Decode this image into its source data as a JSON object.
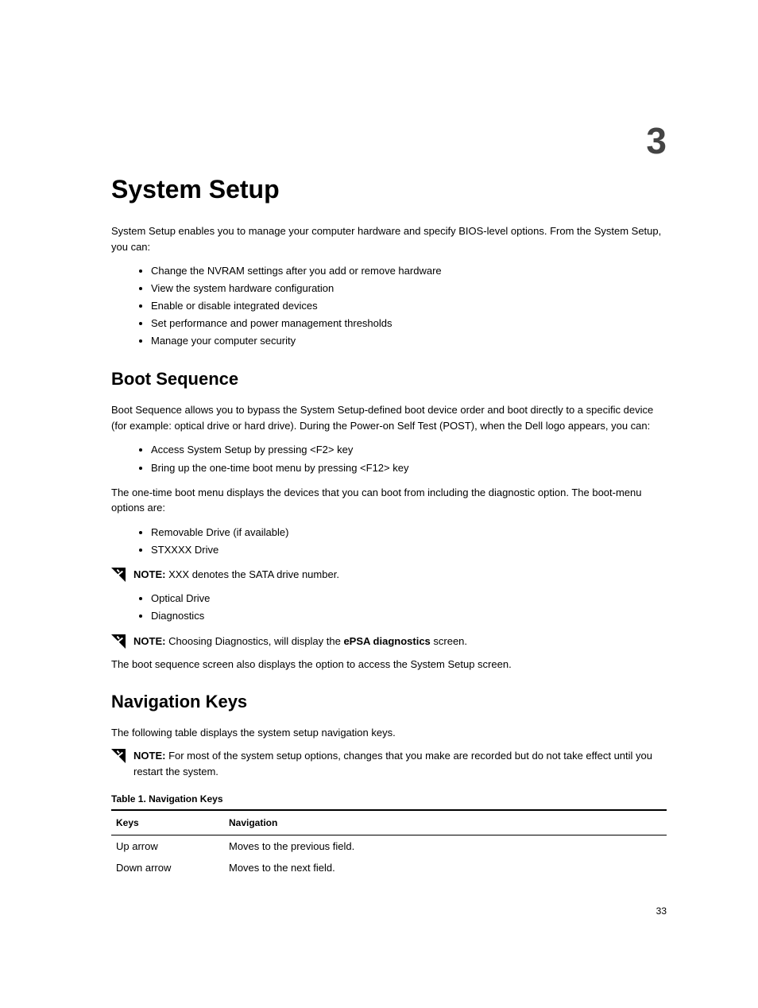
{
  "chapter": "3",
  "title": "System Setup",
  "introParagraph": "System Setup enables you to manage your computer hardware and specify BIOS-level options. From the System Setup, you can:",
  "introList": [
    "Change the NVRAM settings after you add or remove hardware",
    "View the system hardware configuration",
    "Enable or disable integrated devices",
    "Set performance and power management thresholds",
    "Manage your computer security"
  ],
  "bootSequence": {
    "heading": "Boot Sequence",
    "p1": "Boot Sequence allows you to bypass the System Setup-defined boot device order and boot directly to a specific device (for example: optical drive or hard drive). During the Power-on Self Test (POST), when the Dell logo appears, you can:",
    "list1": [
      "Access System Setup by pressing <F2> key",
      "Bring up the one-time boot menu by pressing <F12> key"
    ],
    "p2": "The one-time boot menu displays the devices that you can boot from including the diagnostic option. The boot-menu options are:",
    "list2": [
      "Removable Drive (if available)",
      "STXXXX Drive"
    ],
    "note1Label": "NOTE:",
    "note1Text": " XXX denotes the SATA drive number.",
    "list3": [
      "Optical Drive",
      "Diagnostics"
    ],
    "note2Label": "NOTE:",
    "note2Prefix": " Choosing Diagnostics, will display the ",
    "note2Bold": "ePSA diagnostics",
    "note2Suffix": " screen.",
    "p3": "The boot sequence screen also displays the option to access the System Setup screen."
  },
  "navKeys": {
    "heading": "Navigation Keys",
    "p1": "The following table displays the system setup navigation keys.",
    "noteLabel": "NOTE:",
    "noteText": " For most of the system setup options, changes that you make are recorded but do not take effect until you restart the system.",
    "tableCaption": "Table 1. Navigation Keys",
    "headers": {
      "col1": "Keys",
      "col2": "Navigation"
    },
    "rows": [
      {
        "key": "Up arrow",
        "nav": "Moves to the previous field."
      },
      {
        "key": "Down arrow",
        "nav": "Moves to the next field."
      }
    ]
  },
  "pageNumber": "33"
}
